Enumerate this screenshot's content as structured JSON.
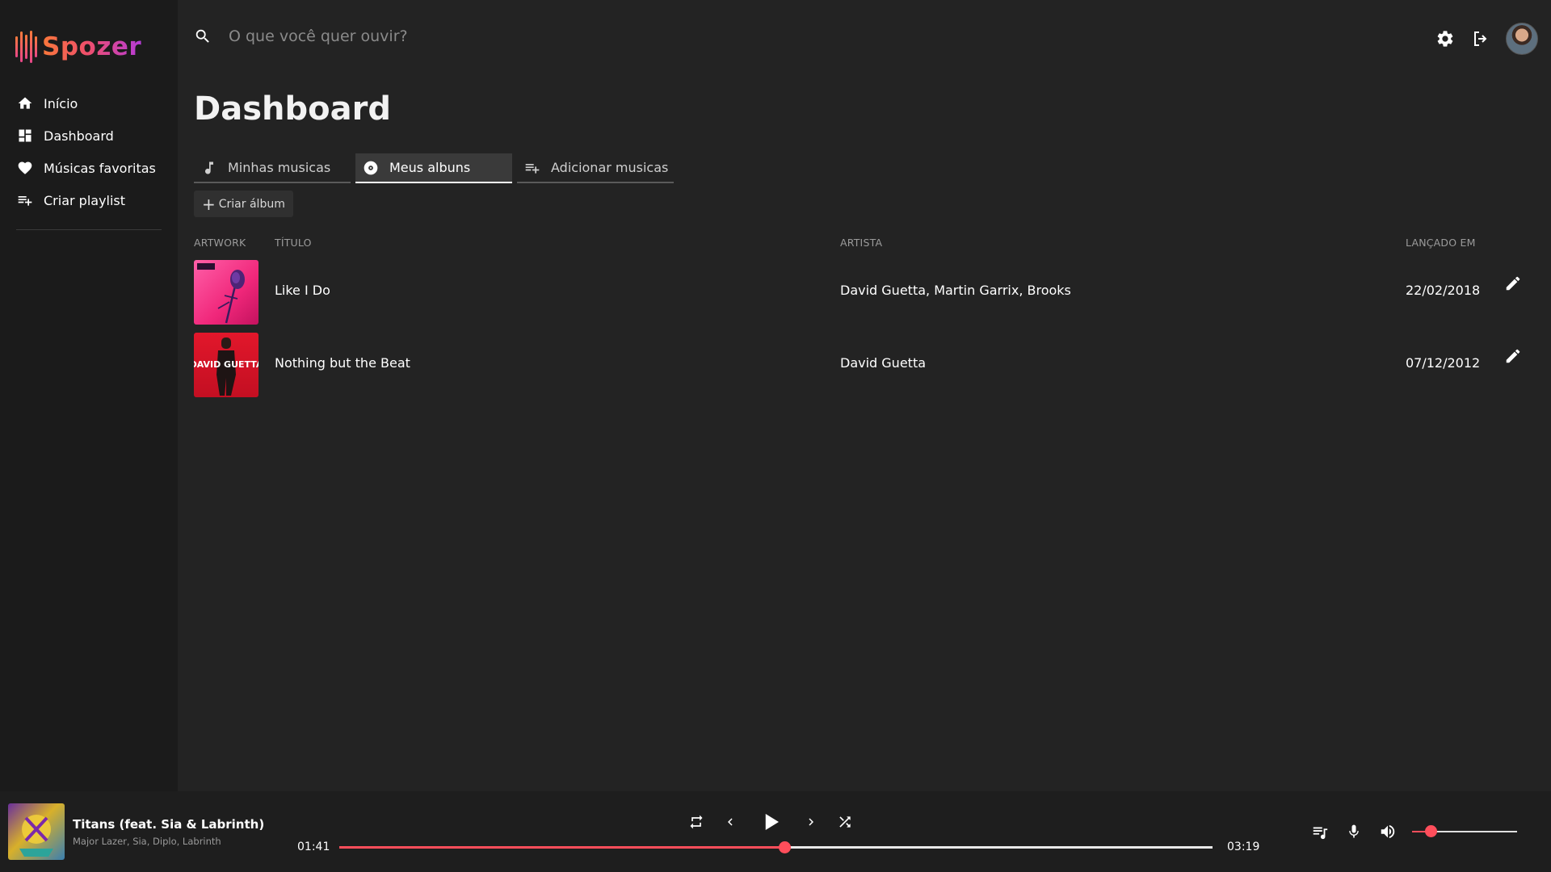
{
  "app": {
    "name": "Spozer",
    "accent": "#ff4e5b"
  },
  "sidebar": {
    "items": [
      {
        "label": "Início",
        "icon": "home-icon"
      },
      {
        "label": "Dashboard",
        "icon": "dashboard-icon"
      },
      {
        "label": "Músicas favoritas",
        "icon": "heart-icon"
      },
      {
        "label": "Criar playlist",
        "icon": "playlist-add-icon"
      }
    ]
  },
  "search": {
    "placeholder": "O que você quer ouvir?",
    "value": ""
  },
  "header": {
    "icons": [
      "settings-icon",
      "logout-icon",
      "avatar"
    ]
  },
  "main": {
    "title": "Dashboard",
    "tabs": [
      {
        "label": "Minhas musicas",
        "icon": "music-note-icon",
        "active": false
      },
      {
        "label": "Meus albuns",
        "icon": "album-icon",
        "active": true
      },
      {
        "label": "Adicionar musicas",
        "icon": "playlist-add-icon",
        "active": false
      }
    ],
    "create_album_label": "Criar álbum",
    "table": {
      "headers": {
        "artwork": "ARTWORK",
        "title": "TÍTULO",
        "artist": "ARTISTA",
        "released": "LANÇADO EM"
      },
      "rows": [
        {
          "title": "Like I Do",
          "artists": "David Guetta, Martin Garrix, Brooks",
          "released": "22/02/2018"
        },
        {
          "title": "Nothing but the Beat",
          "artists": "David Guetta",
          "released": "07/12/2012"
        }
      ]
    }
  },
  "player": {
    "title": "Titans (feat. Sia & Labrinth)",
    "artists": "Major Lazer, Sia, Diplo, Labrinth",
    "current_time": "01:41",
    "total_time": "03:19",
    "progress": 0.51,
    "volume": 0.18
  }
}
